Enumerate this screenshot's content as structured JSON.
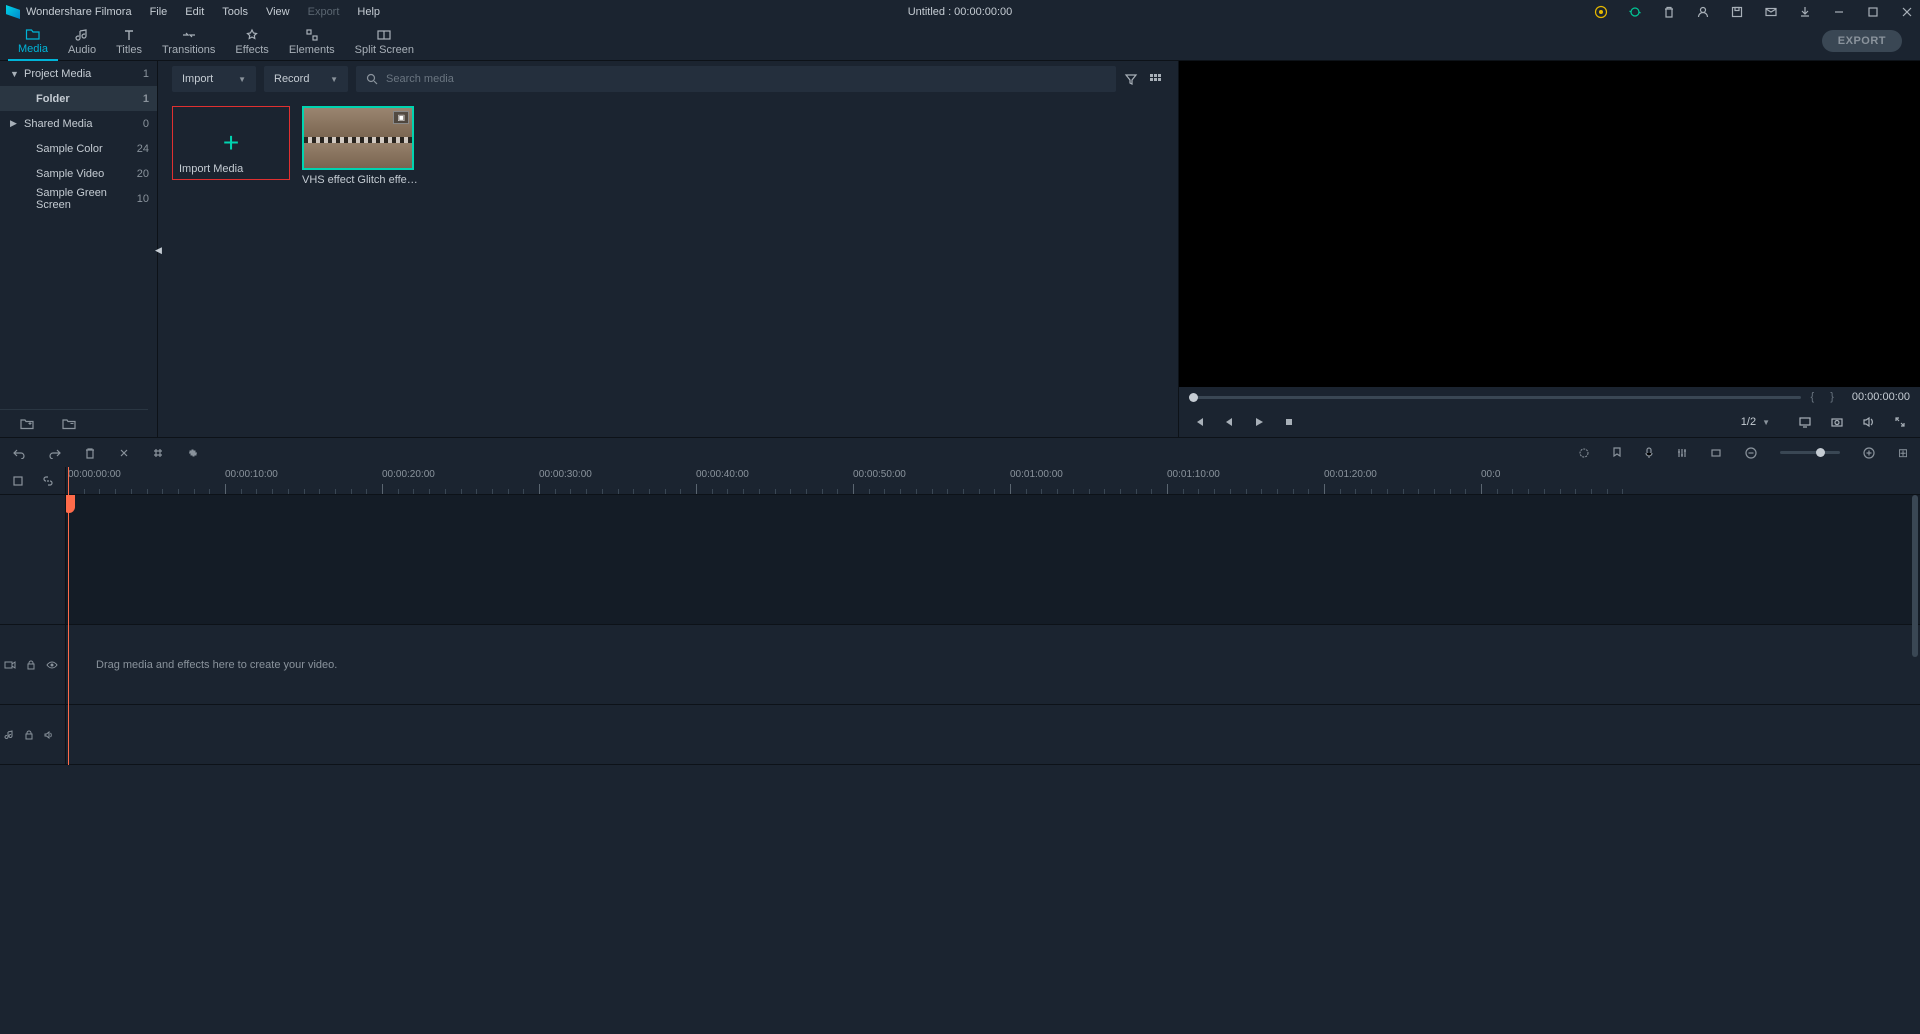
{
  "app_name": "Wondershare Filmora",
  "menu": [
    "File",
    "Edit",
    "Tools",
    "View",
    "Export",
    "Help"
  ],
  "menu_dim_index": 4,
  "doc_title": "Untitled : 00:00:00:00",
  "tabs": [
    {
      "label": "Media",
      "active": true
    },
    {
      "label": "Audio"
    },
    {
      "label": "Titles"
    },
    {
      "label": "Transitions"
    },
    {
      "label": "Effects"
    },
    {
      "label": "Elements"
    },
    {
      "label": "Split Screen"
    }
  ],
  "export_btn": "EXPORT",
  "sidebar_items": [
    {
      "label": "Project Media",
      "count": "1",
      "arrow": "▼"
    },
    {
      "label": "Folder",
      "count": "1",
      "indent": true,
      "selected": true
    },
    {
      "label": "Shared Media",
      "count": "0",
      "arrow": "▶"
    },
    {
      "label": "Sample Color",
      "count": "24",
      "indent": true
    },
    {
      "label": "Sample Video",
      "count": "20",
      "indent": true
    },
    {
      "label": "Sample Green Screen",
      "count": "10",
      "indent": true
    }
  ],
  "import_dd": "Import",
  "record_dd": "Record",
  "search_placeholder": "Search media",
  "import_card_caption": "Import Media",
  "clip_caption": "VHS effect Glitch effect…",
  "preview_time": "00:00:00:00",
  "preview_page": "1/2",
  "ruler_ticks": [
    "00:00:00:00",
    "00:00:10:00",
    "00:00:20:00",
    "00:00:30:00",
    "00:00:40:00",
    "00:00:50:00",
    "00:01:00:00",
    "00:01:10:00",
    "00:01:20:00",
    "00:0"
  ],
  "track_hint": "Drag media and effects here to create your video.",
  "colors": {
    "accent": "#00b4d8",
    "danger": "#e03030",
    "play": "#ff6b4a",
    "green": "#00d4b0"
  }
}
